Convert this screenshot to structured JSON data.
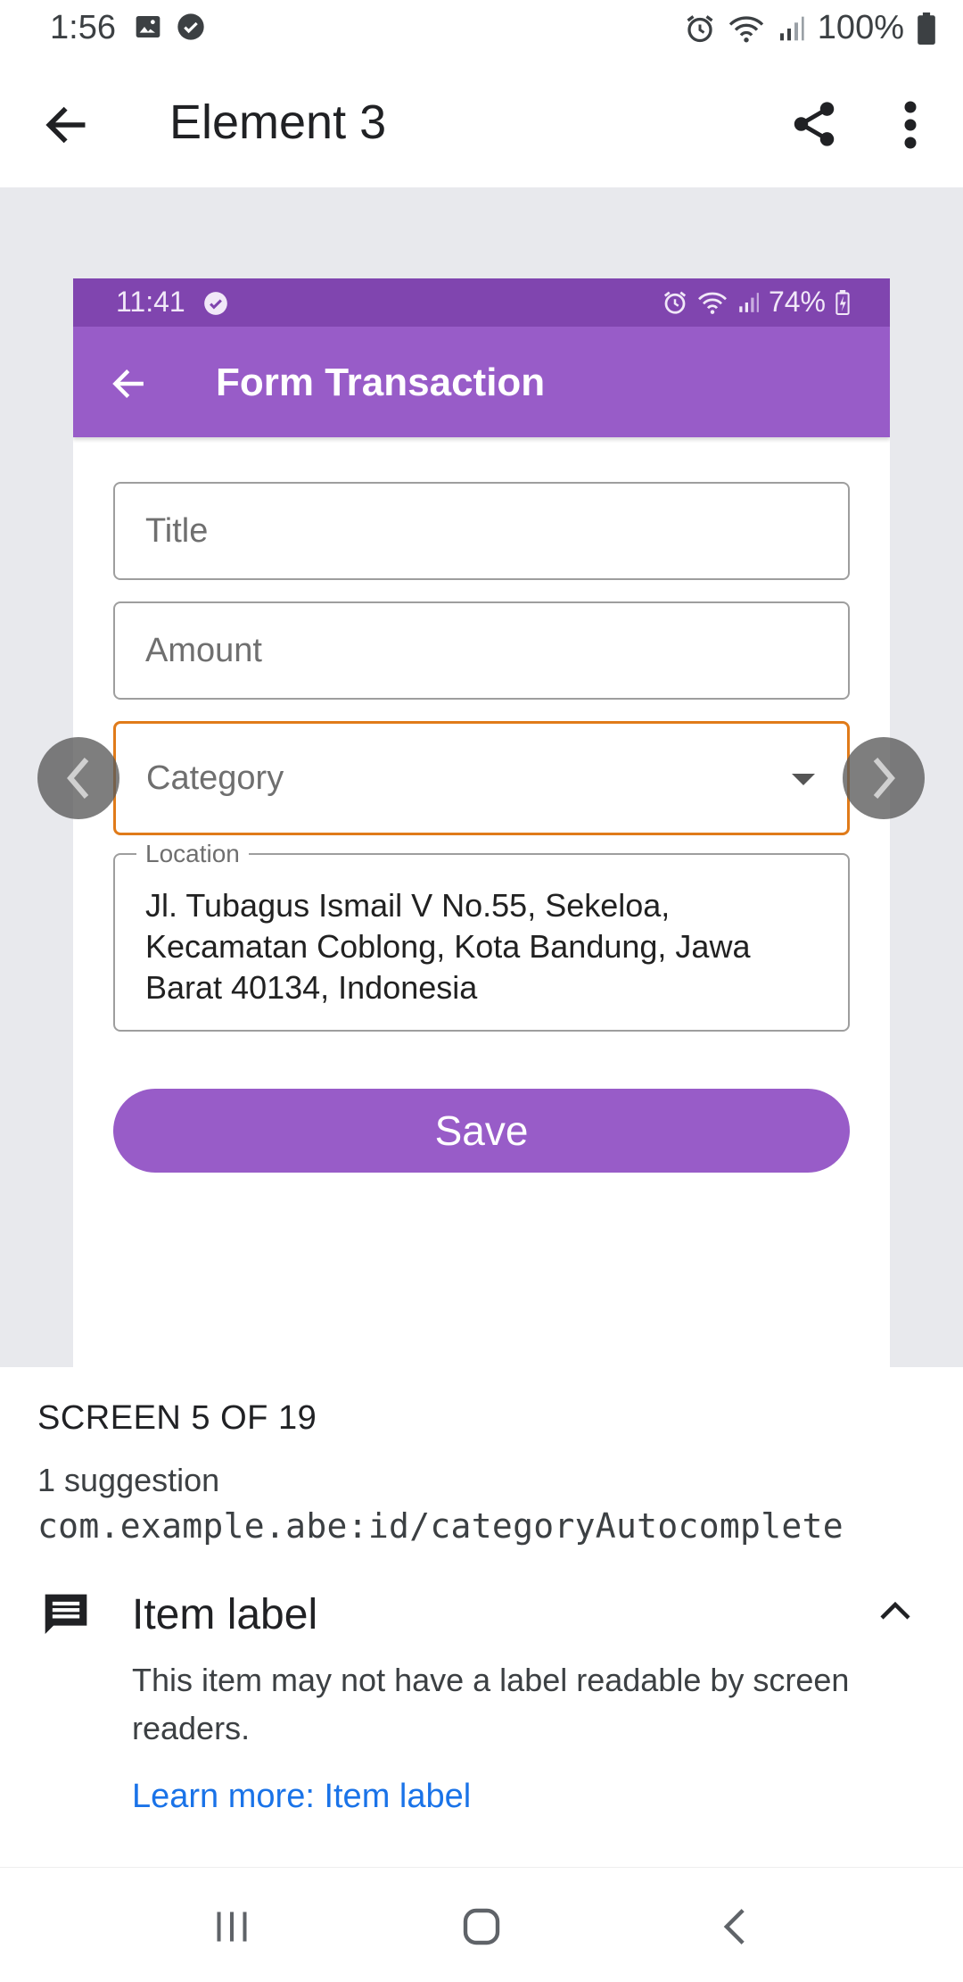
{
  "status_bar": {
    "time": "1:56",
    "battery": "100%"
  },
  "app_bar": {
    "title": "Element 3"
  },
  "preview": {
    "status": {
      "time": "11:41",
      "battery": "74%"
    },
    "toolbar": {
      "title": "Form Transaction"
    },
    "form": {
      "title_placeholder": "Title",
      "amount_placeholder": "Amount",
      "category_placeholder": "Category",
      "location_label": "Location",
      "location_value": "Jl. Tubagus Ismail V No.55, Sekeloa, Kecamatan Coblong, Kota Bandung, Jawa Barat 40134, Indonesia",
      "save_label": "Save"
    },
    "highlight_color": "#e07b1a",
    "accent_color": "#985cc8"
  },
  "sheet": {
    "screen_count": "SCREEN 5 OF 19",
    "suggestions": "1 suggestion",
    "resource_id": "com.example.abe:id/categoryAutocomplete",
    "item_label": "Item label",
    "item_description": "This item may not have a label readable by screen readers.",
    "learn_more": "Learn more: Item label",
    "link_color": "#1a73e8"
  },
  "icons": {
    "status_left": [
      "image-icon",
      "check-circle-icon"
    ],
    "status_right": [
      "alarm-icon",
      "wifi-icon",
      "signal-icon",
      "battery-icon"
    ],
    "app_bar": [
      "back-arrow-icon",
      "share-icon",
      "more-vert-icon"
    ],
    "system_nav": [
      "recent-apps-icon",
      "home-icon",
      "back-icon"
    ]
  }
}
